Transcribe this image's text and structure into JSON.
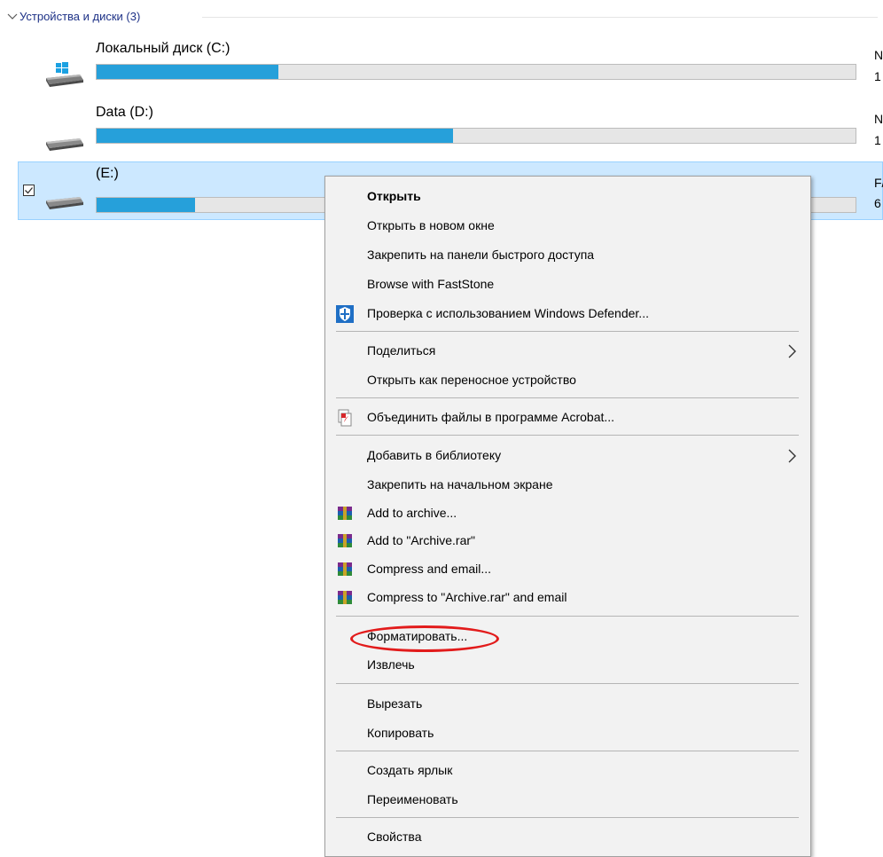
{
  "section": {
    "title": "Устройства и диски (3)",
    "chevron_icon": "chevron-down-icon"
  },
  "drives": [
    {
      "name": "Локальный диск (C:)",
      "used_fraction": 0.24,
      "side_label_1": "N",
      "side_label_2": "1",
      "icon": "windows-drive-icon",
      "selected": false,
      "checked": false
    },
    {
      "name": "Data (D:)",
      "used_fraction": 0.47,
      "side_label_1": "N",
      "side_label_2": "1",
      "icon": "hard-drive-icon",
      "selected": false,
      "checked": false
    },
    {
      "name": "(E:)",
      "used_fraction": 0.13,
      "side_label_1": "F/",
      "side_label_2": "6",
      "icon": "hard-drive-icon",
      "selected": true,
      "checked": true
    }
  ],
  "context_menu": {
    "items": [
      {
        "label": "Открыть",
        "bold": true
      },
      {
        "label": "Открыть в новом окне"
      },
      {
        "label": "Закрепить на панели быстрого доступа"
      },
      {
        "label": "Browse with FastStone"
      },
      {
        "label": "Проверка с использованием Windows Defender...",
        "icon": "windows-defender-icon"
      },
      {
        "label": "Поделиться",
        "submenu": true
      },
      {
        "label": "Открыть как переносное устройство"
      },
      {
        "label": "Объединить файлы в программе Acrobat...",
        "icon": "acrobat-icon"
      },
      {
        "label": "Добавить в библиотеку",
        "submenu": true
      },
      {
        "label": "Закрепить на начальном экране"
      },
      {
        "label": "Add to archive...",
        "icon": "winrar-icon"
      },
      {
        "label": "Add to \"Archive.rar\"",
        "icon": "winrar-icon"
      },
      {
        "label": "Compress and email...",
        "icon": "winrar-icon"
      },
      {
        "label": "Compress to \"Archive.rar\" and email",
        "icon": "winrar-icon"
      },
      {
        "label": "Форматировать...",
        "highlighted": true
      },
      {
        "label": "Извлечь"
      },
      {
        "label": "Вырезать"
      },
      {
        "label": "Копировать"
      },
      {
        "label": "Создать ярлык"
      },
      {
        "label": "Переименовать"
      },
      {
        "label": "Свойства"
      }
    ]
  },
  "colors": {
    "accent": "#26a0da",
    "selection_bg": "#cce8ff",
    "menu_bg": "#f2f2f2",
    "highlight_ring": "#e21b1b",
    "section_title": "#1e3287"
  }
}
